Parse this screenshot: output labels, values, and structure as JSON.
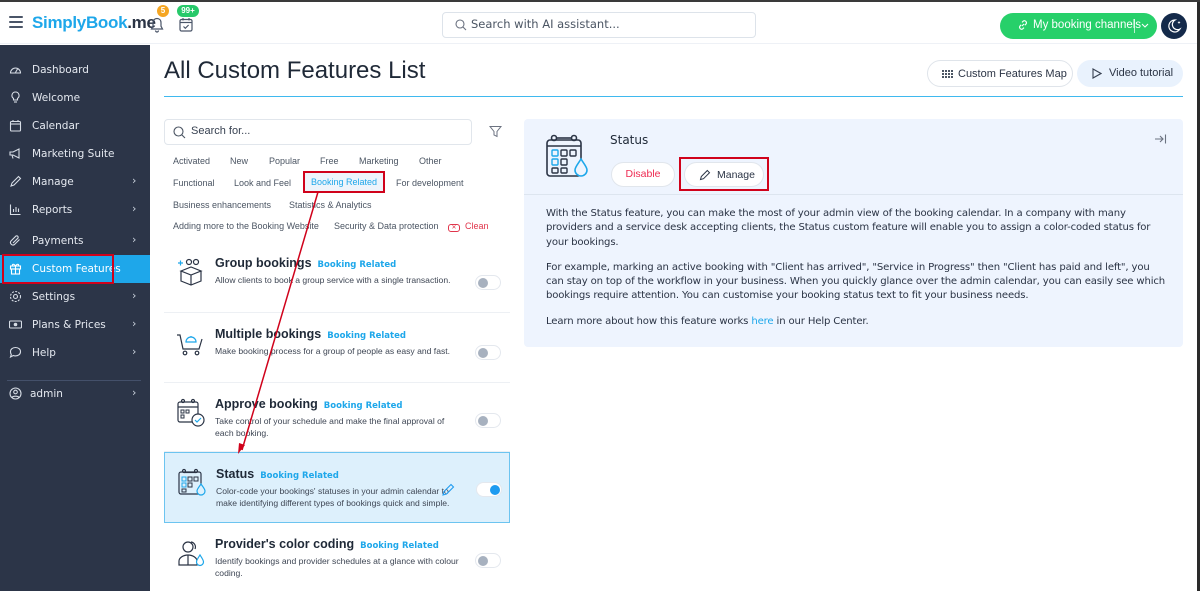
{
  "app": {
    "brand_prefix": "S",
    "brand_main": "implyBook",
    "brand_tld": ".me",
    "notifications_count": "5",
    "bookings_count": "99+"
  },
  "topbar": {
    "ai_search_placeholder": "Search with AI assistant...",
    "channels_label": "My booking channels",
    "icons": [
      "hamburger-icon",
      "bell-icon",
      "calendar-check-icon",
      "search-icon",
      "link-icon",
      "chevron-down-icon",
      "moon-icon"
    ]
  },
  "sidebar": {
    "items": [
      {
        "label": "Dashboard",
        "icon": "gauge-icon",
        "has_arrow": false
      },
      {
        "label": "Welcome",
        "icon": "lightbulb-icon",
        "has_arrow": false
      },
      {
        "label": "Calendar",
        "icon": "calendar-icon",
        "has_arrow": false
      },
      {
        "label": "Marketing Suite",
        "icon": "megaphone-icon",
        "has_arrow": false
      },
      {
        "label": "Manage",
        "icon": "pencil-icon",
        "has_arrow": true
      },
      {
        "label": "Reports",
        "icon": "bar-chart-icon",
        "has_arrow": true
      },
      {
        "label": "Payments",
        "icon": "paperclip-icon",
        "has_arrow": true
      },
      {
        "label": "Custom Features",
        "icon": "gift-box-icon",
        "has_arrow": false,
        "active": true
      },
      {
        "label": "Settings",
        "icon": "gear-icon",
        "has_arrow": true
      },
      {
        "label": "Plans & Prices",
        "icon": "banknote-icon",
        "has_arrow": true
      },
      {
        "label": "Help",
        "icon": "chat-bubble-icon",
        "has_arrow": true
      }
    ],
    "user": {
      "label": "admin",
      "icon": "user-circle-icon",
      "has_arrow": true
    }
  },
  "main": {
    "title": "All Custom Features List",
    "map_button": "Custom Features Map",
    "video_button": "Video tutorial",
    "search_placeholder": "Search for...",
    "filters": [
      "Activated",
      "New",
      "Popular",
      "Free",
      "Marketing",
      "Other",
      "Functional",
      "Look and Feel",
      "Booking Related",
      "For development",
      "Business enhancements",
      "Statistics & Analytics",
      "Adding more to the Booking Website",
      "Security & Data protection"
    ],
    "selected_filter": "Booking Related",
    "clean_label": "Clean",
    "features": [
      {
        "title": "Group bookings",
        "tag": "Booking Related",
        "desc": "Allow clients to book a group service with a single transaction.",
        "enabled": false,
        "icon": "group-box-icon"
      },
      {
        "title": "Multiple bookings",
        "tag": "Booking Related",
        "desc": "Make booking process for a group of people as easy and fast.",
        "enabled": false,
        "icon": "cart-icon"
      },
      {
        "title": "Approve booking",
        "tag": "Booking Related",
        "desc": "Take control of your schedule and make the final approval of each booking.",
        "enabled": false,
        "icon": "calendar-approve-icon"
      },
      {
        "title": "Status",
        "tag": "Booking Related",
        "desc": "Color-code your bookings' statuses in your admin calendar to make identifying different types of bookings quick and simple.",
        "enabled": true,
        "selected": true,
        "icon": "calendar-status-icon"
      },
      {
        "title": "Provider's color coding",
        "tag": "Booking Related",
        "desc": "Identify bookings and provider schedules at a glance with colour coding.",
        "enabled": false,
        "icon": "provider-color-icon"
      }
    ]
  },
  "detail": {
    "title": "Status",
    "disable_label": "Disable",
    "manage_label": "Manage",
    "para1": "With the Status feature, you can make the most of your admin view of the booking calendar. In a company with many providers and a service desk accepting clients, the Status custom feature will enable you to assign a color-coded status for your bookings.",
    "para2": "For example, marking an active booking with \"Client has arrived\", \"Service in Progress\" then \"Client has paid and left\", you can stay on top of the workflow in your business. When you quickly glance over the admin calendar, you can easily see which bookings require attention. You can customise your booking status text to fit your business needs.",
    "para3_before": "Learn more about how this feature works ",
    "para3_link": "here",
    "para3_after": " in our Help Center."
  },
  "colors": {
    "accent": "#1ea7ea",
    "sidebar_bg": "#2c3548",
    "success": "#27d06a",
    "danger": "#ee2b52",
    "annotation": "#d0021b"
  }
}
